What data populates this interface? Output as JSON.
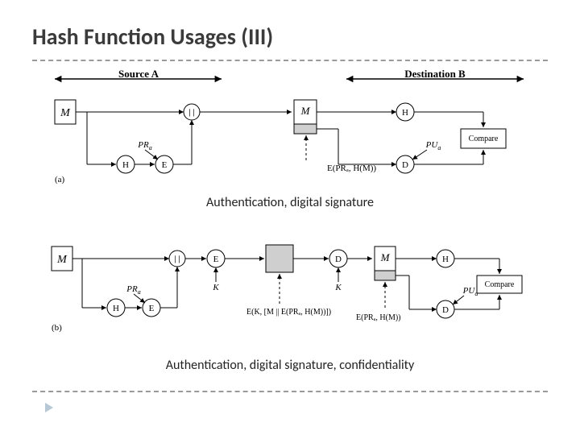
{
  "title": "Hash Function Usages (III)",
  "headers": {
    "source": "Source A",
    "dest": "Destination B"
  },
  "labels": {
    "M": "M",
    "H": "H",
    "E": "E",
    "D": "D",
    "PRa": "PR",
    "PRa_sub": "a",
    "PUa": "PU",
    "PUa_sub": "a",
    "K": "K",
    "compare": "Compare",
    "concat": "||"
  },
  "formula_a": "E(PRₐ, H(M))",
  "formula_b1": "E(K, [M || E(PRₐ, H(M))])",
  "formula_b2": "E(PRₐ, H(M))",
  "caption_a": "Authentication,  digital signature",
  "caption_b": "Authentication, digital signature, confidentiality",
  "panel_a": "(a)",
  "panel_b": "(b)"
}
